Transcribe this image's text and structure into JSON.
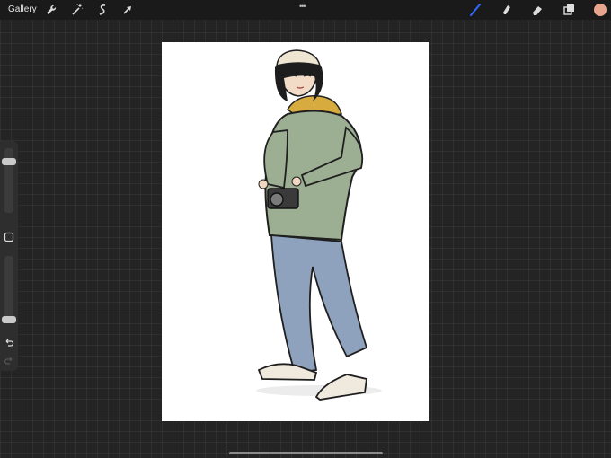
{
  "topbar": {
    "gallery_label": "Gallery",
    "left_tools": [
      "wrench-icon",
      "magic-wand-icon",
      "selection-icon",
      "transform-arrow-icon"
    ],
    "right_tools": [
      "brush-icon",
      "smudge-icon",
      "eraser-icon",
      "layers-icon"
    ],
    "active_tool": "brush-icon",
    "active_tool_color": "#2f6bff",
    "current_color": "#e8a58d"
  },
  "sidebar": {
    "brush_size_level": 0.85,
    "opacity_level": 0.15,
    "controls": [
      "brush-size-slider",
      "modify-button",
      "opacity-slider",
      "undo-icon",
      "redo-icon"
    ]
  },
  "canvas": {
    "background": "#ffffff",
    "artwork": "figure-sketch"
  }
}
